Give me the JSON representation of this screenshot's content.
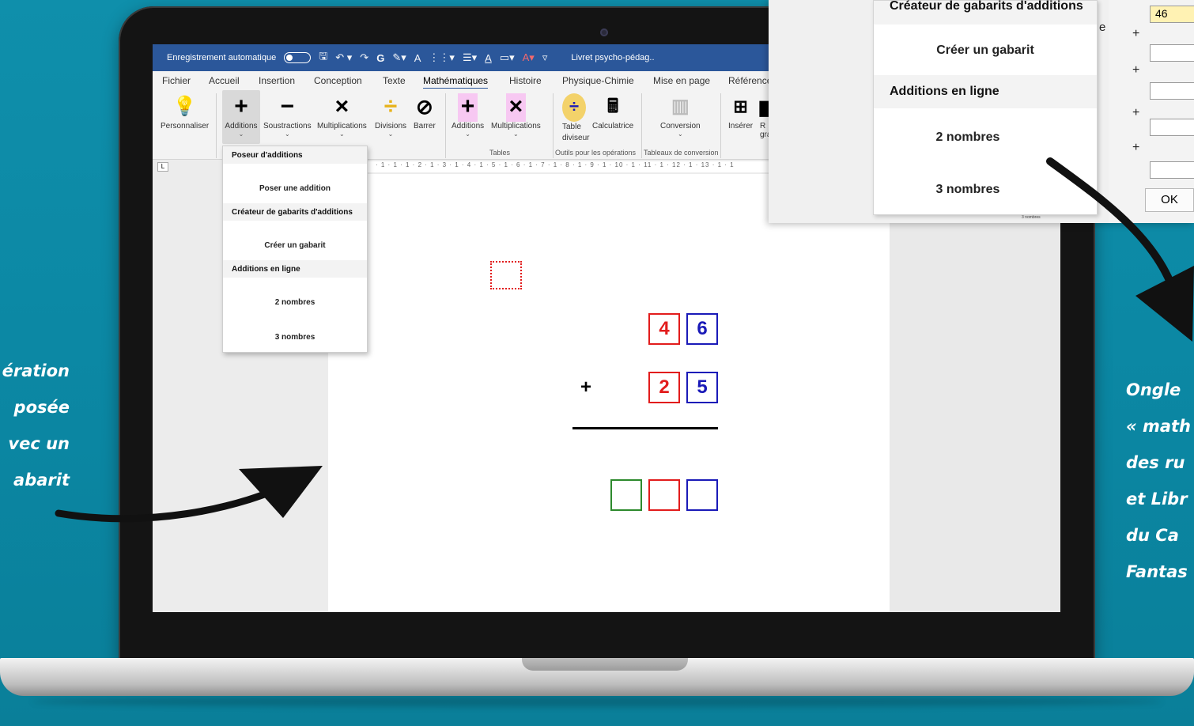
{
  "window": {
    "autosave_label": "Enregistrement automatique",
    "format_glyphs": "G",
    "doc_title": "Livret psycho-pédag.."
  },
  "menubar": {
    "items": [
      "Fichier",
      "Accueil",
      "Insertion",
      "Conception",
      "Texte",
      "Mathématiques",
      "Histoire",
      "Physique-Chimie",
      "Mise en page",
      "Référence"
    ],
    "active": "Mathématiques"
  },
  "ribbon": {
    "personnaliser": "Personnaliser",
    "additions": "Additions",
    "soustractions": "Soustractions",
    "multiplications": "Multiplications",
    "divisions": "Divisions",
    "barrer": "Barrer",
    "table_additions": "Additions",
    "table_multiplications": "Multiplications",
    "table_group": "Tables",
    "table_diviseur": "Table diviseur",
    "calculatrice": "Calculatrice",
    "outils_group": "Outils pour les opérations",
    "conversion": "Conversion",
    "tableaux_group": "Tableaux de conversion",
    "inserer": "Insérer",
    "r_label": "R",
    "gra_label": "gra"
  },
  "ruler_text": "· 1 · 1 · 1 · 2 · 1 · 3 · 1 · 4 · 1 · 5 · 1 · 6 · 1 · 7 · 1 · 8 · 1 · 9 · 1 · 10 · 1 · 11 · 1 · 12 · 1 · 13 · 1 · 1",
  "ruler_corner": "L",
  "dropdown": {
    "poseur_header": "Poseur d'additions",
    "poser_item": "Poser une addition",
    "createur_header": "Créateur de gabarits d'additions",
    "creer_item": "Créer un gabarit",
    "ligne_header": "Additions en ligne",
    "deux_item": "2 nombres",
    "trois_item": "3 nombres"
  },
  "addition": {
    "operator": "+",
    "row1": [
      "4",
      "6"
    ],
    "row2": [
      "2",
      "5"
    ]
  },
  "inset": {
    "partial_text": "e l'",
    "field_value": "46",
    "plus_sign": "+",
    "ok_label": "OK",
    "mini_text": "3 nombres"
  },
  "captions": {
    "left": [
      "ération",
      "posée",
      "vec un",
      "abarit"
    ],
    "right": [
      "Ongle",
      "« math",
      "des ru",
      "et Libr",
      "du Ca",
      "Fantas"
    ]
  }
}
